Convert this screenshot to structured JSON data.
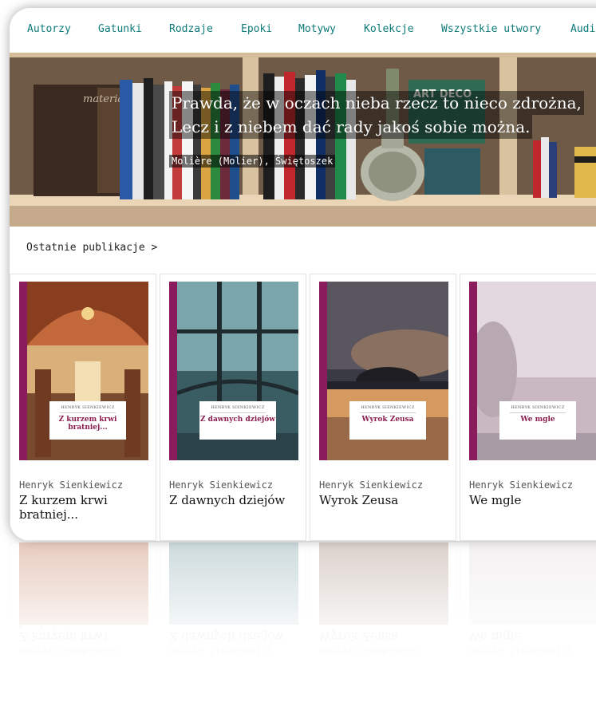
{
  "nav": {
    "items": [
      "Autorzy",
      "Gatunki",
      "Rodzaje",
      "Epoki",
      "Motywy",
      "Kolekcje",
      "Wszystkie utwory",
      "Audi"
    ]
  },
  "hero": {
    "quote_line1": "Prawda, że w oczach nieba rzecz to nieco zdrożna,",
    "quote_line2": "Lecz i z niebem dać rady jakoś sobie można.",
    "author": "Molière (Molier), Świętoszek",
    "sign_text": "ART DECO",
    "book_spine_text": "materials"
  },
  "section": {
    "title": "Ostatnie publikacje >"
  },
  "books": [
    {
      "author": "Henryk Sienkiewicz",
      "title": "Z kurzem krwi bratniej...",
      "cover_label_author": "HENRYK SIENKIEWICZ",
      "cover_label_title": "Z kurzem krwi bratniej...",
      "stripe_color": "#8a1c5e",
      "cover_colors": [
        "#b0552b",
        "#7a3a22",
        "#e1c49a"
      ]
    },
    {
      "author": "Henryk Sienkiewicz",
      "title": "Z dawnych dziejów",
      "cover_label_author": "HENRYK SIENKIEWICZ",
      "cover_label_title": "Z dawnych dziejów",
      "stripe_color": "#8a1c5e",
      "cover_colors": [
        "#5c8a8f",
        "#2a4c55",
        "#9fc0c5"
      ]
    },
    {
      "author": "Henryk Sienkiewicz",
      "title": "Wyrok Zeusa",
      "cover_label_author": "HENRYK SIENKIEWICZ",
      "cover_label_title": "Wyrok Zeusa",
      "stripe_color": "#8a1c5e",
      "cover_colors": [
        "#3a3a44",
        "#8a6a55",
        "#e0a060"
      ]
    },
    {
      "author": "Henryk Sienkiewicz",
      "title": "We mgle",
      "cover_label_author": "HENRYK SIENKIEWICZ",
      "cover_label_title": "We mgle",
      "stripe_color": "#8a1c5e",
      "cover_colors": [
        "#d8cfd6",
        "#b9a8b4",
        "#efe8ec"
      ]
    }
  ]
}
